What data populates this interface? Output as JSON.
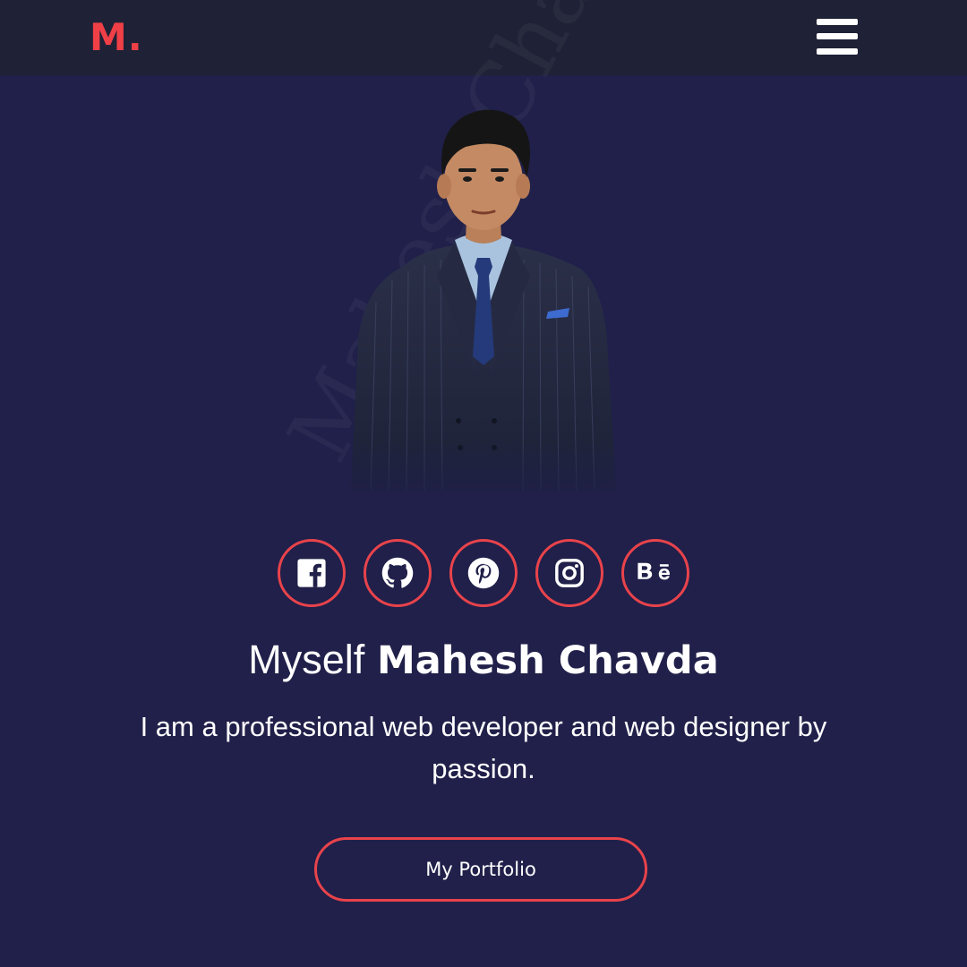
{
  "nav": {
    "logo": "M.",
    "menu_icon": "hamburger-menu-icon"
  },
  "hero": {
    "watermark": "Mahesh Chavda",
    "photo_alt": "Profile photo of Mahesh Chavda",
    "social": [
      {
        "name": "facebook",
        "icon": "facebook-icon"
      },
      {
        "name": "github",
        "icon": "github-icon"
      },
      {
        "name": "pinterest",
        "icon": "pinterest-icon"
      },
      {
        "name": "instagram",
        "icon": "instagram-icon"
      },
      {
        "name": "behance",
        "icon": "behance-icon"
      }
    ],
    "title_prefix": "Myself",
    "title_name": "Mahesh Chavda",
    "tagline": "I am a professional web developer and web designer by passion.",
    "button_label": "My Portfolio"
  },
  "colors": {
    "accent": "#e8434b",
    "nav_bg": "#1f2136",
    "hero_bg": "#20204a",
    "text": "#ffffff"
  }
}
